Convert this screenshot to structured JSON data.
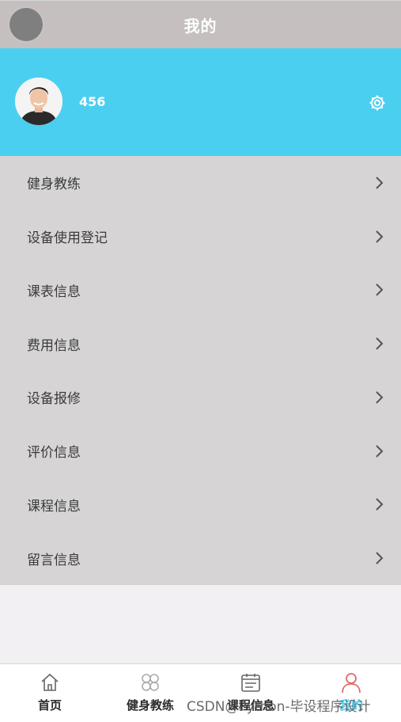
{
  "header": {
    "title": "我的"
  },
  "profile": {
    "username": "456",
    "settings_icon": "gear-icon"
  },
  "menu": {
    "items": [
      {
        "label": "健身教练"
      },
      {
        "label": "设备使用登记"
      },
      {
        "label": "课表信息"
      },
      {
        "label": "费用信息"
      },
      {
        "label": "设备报修"
      },
      {
        "label": "评价信息"
      },
      {
        "label": "课程信息"
      },
      {
        "label": "留言信息"
      }
    ]
  },
  "tabbar": {
    "tabs": [
      {
        "label": "首页",
        "icon": "home-icon"
      },
      {
        "label": "健身教练",
        "icon": "grid-icon"
      },
      {
        "label": "课程信息",
        "icon": "calendar-icon"
      },
      {
        "label": "我的",
        "icon": "user-icon",
        "active": true
      }
    ]
  },
  "watermark": "CSDN@Python-毕设程序设计",
  "colors": {
    "header_bg": "#c5bfbf",
    "profile_bg": "#4bcff0",
    "menu_bg": "#d6d4d4",
    "active_tab": "#e06a6a"
  }
}
